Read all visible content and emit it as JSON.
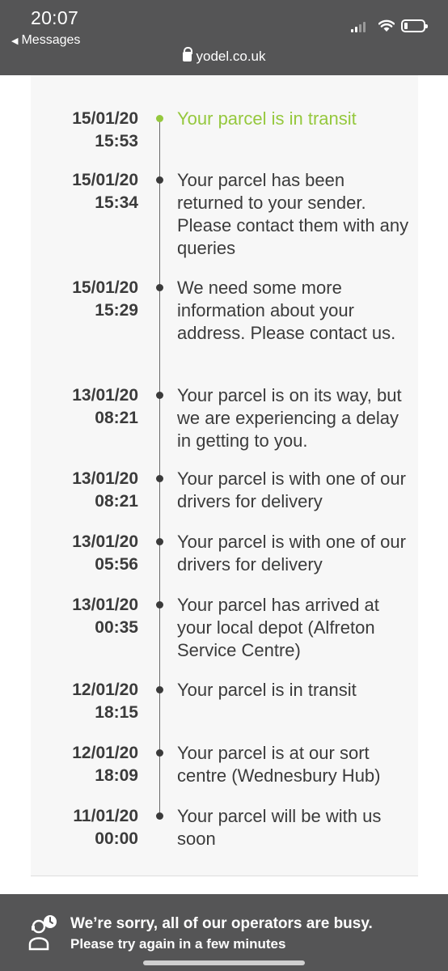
{
  "status_bar": {
    "time": "20:07",
    "back_label": "Messages"
  },
  "browser": {
    "url": "yodel.co.uk"
  },
  "timeline": {
    "events": [
      {
        "date": "15/01/20",
        "time": "15:53",
        "text": "Your parcel is in transit",
        "current": true
      },
      {
        "date": "15/01/20",
        "time": "15:34",
        "text": "Your parcel has been returned to your sender. Please contact them with any queries",
        "current": false
      },
      {
        "date": "15/01/20",
        "time": "15:29",
        "text": "We need some more information about your address. Please contact us.",
        "current": false
      },
      {
        "date": "13/01/20",
        "time": "08:21",
        "text": "Your parcel is on its way, but we are experiencing a delay in getting to you.",
        "current": false
      },
      {
        "date": "13/01/20",
        "time": "08:21",
        "text": "Your parcel is with one of our drivers for delivery",
        "current": false
      },
      {
        "date": "13/01/20",
        "time": "05:56",
        "text": "Your parcel is with one of our drivers for delivery",
        "current": false
      },
      {
        "date": "13/01/20",
        "time": "00:35",
        "text": "Your parcel has arrived at your local depot (Alfreton Service Centre)",
        "current": false
      },
      {
        "date": "12/01/20",
        "time": "18:15",
        "text": "Your parcel is in transit",
        "current": false
      },
      {
        "date": "12/01/20",
        "time": "18:09",
        "text": "Your parcel is at our sort centre (Wednesbury Hub)",
        "current": false
      },
      {
        "date": "11/01/20",
        "time": "00:00",
        "text": "Your parcel will be with us soon",
        "current": false
      }
    ]
  },
  "chat": {
    "title": "We’re sorry, all of our operators are busy.",
    "subtitle": "Please try again in a few minutes",
    "icon": "support-agent-clock-icon"
  },
  "colors": {
    "header_bg": "#555556",
    "accent_green": "#95c83d",
    "text_dark": "#3b3b3b",
    "card_bg": "#f7f7f7"
  }
}
